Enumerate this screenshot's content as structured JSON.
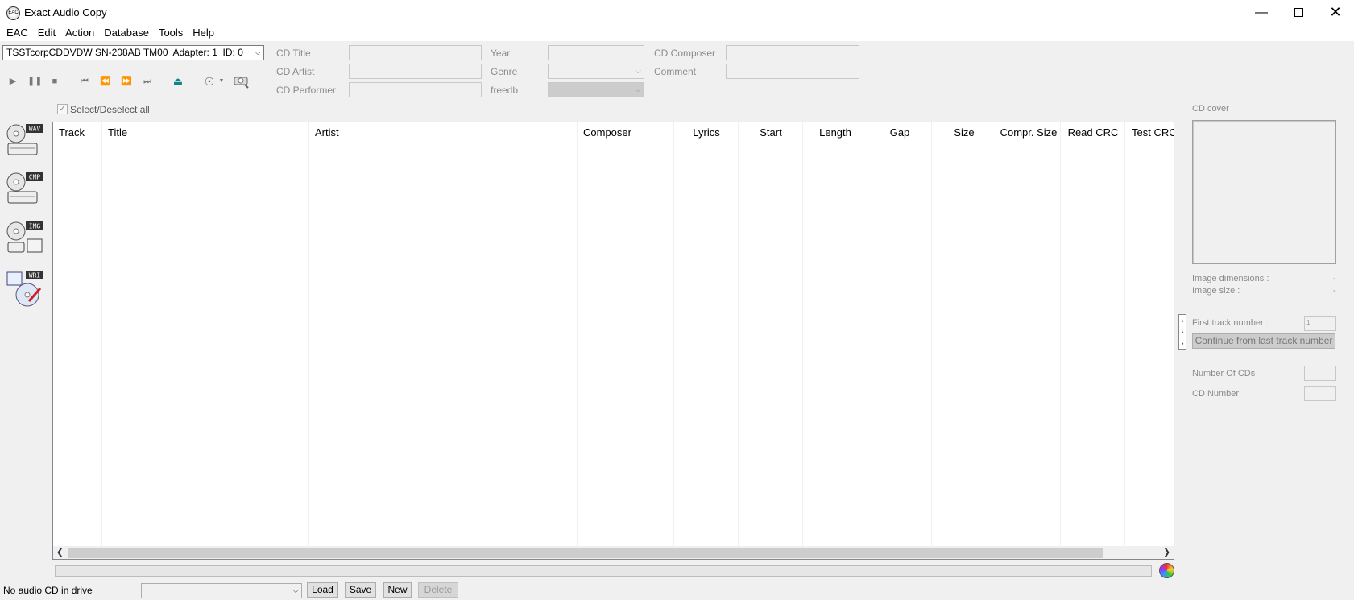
{
  "window": {
    "title": "Exact Audio Copy",
    "icon_text": "EAC"
  },
  "menu": [
    "EAC",
    "Edit",
    "Action",
    "Database",
    "Tools",
    "Help"
  ],
  "drive": {
    "selected": "TSSTcorpCDDVDW SN-208AB TM00  Adapter: 1  ID: 0"
  },
  "metadata": {
    "cd_title_label": "CD Title",
    "cd_artist_label": "CD Artist",
    "cd_performer_label": "CD Performer",
    "year_label": "Year",
    "genre_label": "Genre",
    "freedb_label": "freedb",
    "cd_composer_label": "CD Composer",
    "comment_label": "Comment"
  },
  "select_all_label": "Select/Deselect all",
  "side_tools": [
    {
      "badge": "WAV"
    },
    {
      "badge": "CMP"
    },
    {
      "badge": "IMG"
    },
    {
      "badge": "WRI"
    }
  ],
  "table": {
    "columns": [
      "Track",
      "Title",
      "Artist",
      "Composer",
      "Lyrics",
      "Start",
      "Length",
      "Gap",
      "Size",
      "Compr. Size",
      "Read CRC",
      "Test CRC"
    ]
  },
  "status": {
    "text": "No audio CD in drive",
    "load": "Load",
    "save": "Save",
    "new": "New",
    "delete": "Delete"
  },
  "right_panel": {
    "cover_label": "CD cover",
    "image_dimensions_label": "Image dimensions :",
    "image_dimensions_value": "-",
    "image_size_label": "Image size :",
    "image_size_value": "-",
    "first_track_label": "First track number :",
    "first_track_value": "1",
    "continue_label": "Continue from last track number",
    "num_cds_label": "Number Of CDs",
    "cd_number_label": "CD Number"
  }
}
